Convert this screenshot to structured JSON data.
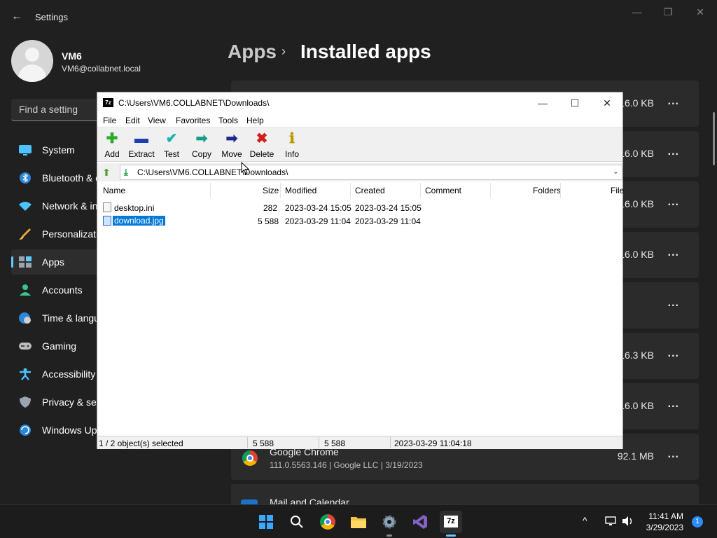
{
  "settings": {
    "title": "Settings",
    "user": {
      "name": "VM6",
      "email": "VM6@collabnet.local"
    },
    "search_placeholder": "Find a setting",
    "nav": [
      {
        "label": "System",
        "icon": "monitor-icon"
      },
      {
        "label": "Bluetooth & devices",
        "icon": "bluetooth-icon"
      },
      {
        "label": "Network & internet",
        "icon": "wifi-icon"
      },
      {
        "label": "Personalization",
        "icon": "brush-icon"
      },
      {
        "label": "Apps",
        "icon": "apps-icon",
        "active": true
      },
      {
        "label": "Accounts",
        "icon": "person-icon"
      },
      {
        "label": "Time & language",
        "icon": "clock-globe-icon"
      },
      {
        "label": "Gaming",
        "icon": "gamepad-icon"
      },
      {
        "label": "Accessibility",
        "icon": "accessibility-icon"
      },
      {
        "label": "Privacy & security",
        "icon": "shield-icon"
      },
      {
        "label": "Windows Update",
        "icon": "update-icon"
      }
    ],
    "breadcrumb": {
      "parent": "Apps",
      "separator": "›",
      "current": "Installed apps"
    },
    "apps": [
      {
        "size": "16.0 KB",
        "more": "..."
      },
      {
        "size": "16.0 KB",
        "more": "..."
      },
      {
        "size": "16.0 KB",
        "more": "..."
      },
      {
        "size": "16.0 KB",
        "more": "..."
      },
      {
        "size": "",
        "more": "..."
      },
      {
        "size": "16.3 KB",
        "more": "..."
      },
      {
        "size": "16.0 KB",
        "more": "..."
      },
      {
        "name": "Google Chrome",
        "meta": "111.0.5563.146 | Google LLC | 3/19/2023",
        "size": "92.1 MB",
        "more": "..."
      },
      {
        "name": "Mail and Calendar",
        "size": "",
        "more": ""
      }
    ]
  },
  "zip": {
    "title": "C:\\Users\\VM6.COLLABNET\\Downloads\\",
    "logo": "7z",
    "menu": [
      "File",
      "Edit",
      "View",
      "Favorites",
      "Tools",
      "Help"
    ],
    "toolbar": [
      {
        "label": "Add",
        "icon": "plus-icon",
        "glyph": "✚",
        "color": "#2eaa2e"
      },
      {
        "label": "Extract",
        "icon": "minus-icon",
        "glyph": "▬",
        "color": "#1d3fb3"
      },
      {
        "label": "Test",
        "icon": "check-icon",
        "glyph": "✔",
        "color": "#1ab3b3"
      },
      {
        "label": "Copy",
        "icon": "copy-arrow-icon",
        "glyph": "➡",
        "color": "#1a9a8a"
      },
      {
        "label": "Move",
        "icon": "move-arrow-icon",
        "glyph": "➡",
        "color": "#1d2a8a"
      },
      {
        "label": "Delete",
        "icon": "delete-x-icon",
        "glyph": "✖",
        "color": "#d02020"
      },
      {
        "label": "Info",
        "icon": "info-icon",
        "glyph": "ℹ",
        "color": "#b89a00"
      }
    ],
    "address": "C:\\Users\\VM6.COLLABNET\\Downloads\\",
    "columns": [
      "Name",
      "Size",
      "Modified",
      "Created",
      "Comment",
      "Folders",
      "File"
    ],
    "files": [
      {
        "name": "desktop.ini",
        "size": "282",
        "modified": "2023-03-24 15:05",
        "created": "2023-03-24 15:05"
      },
      {
        "name": "download.jpg",
        "size": "5 588",
        "modified": "2023-03-29 11:04",
        "created": "2023-03-29 11:04",
        "selected": true
      }
    ],
    "status": {
      "selection": "1 / 2 object(s) selected",
      "size1": "5 588",
      "size2": "5 588",
      "datetime": "2023-03-29 11:04:18"
    }
  },
  "taskbar": {
    "apps": [
      {
        "name": "start"
      },
      {
        "name": "search"
      },
      {
        "name": "chrome"
      },
      {
        "name": "file-explorer"
      },
      {
        "name": "settings"
      },
      {
        "name": "visual-studio"
      },
      {
        "name": "7zip",
        "label": "7z"
      }
    ],
    "time": "11:41 AM",
    "date": "3/29/2023",
    "notifications": "1"
  }
}
